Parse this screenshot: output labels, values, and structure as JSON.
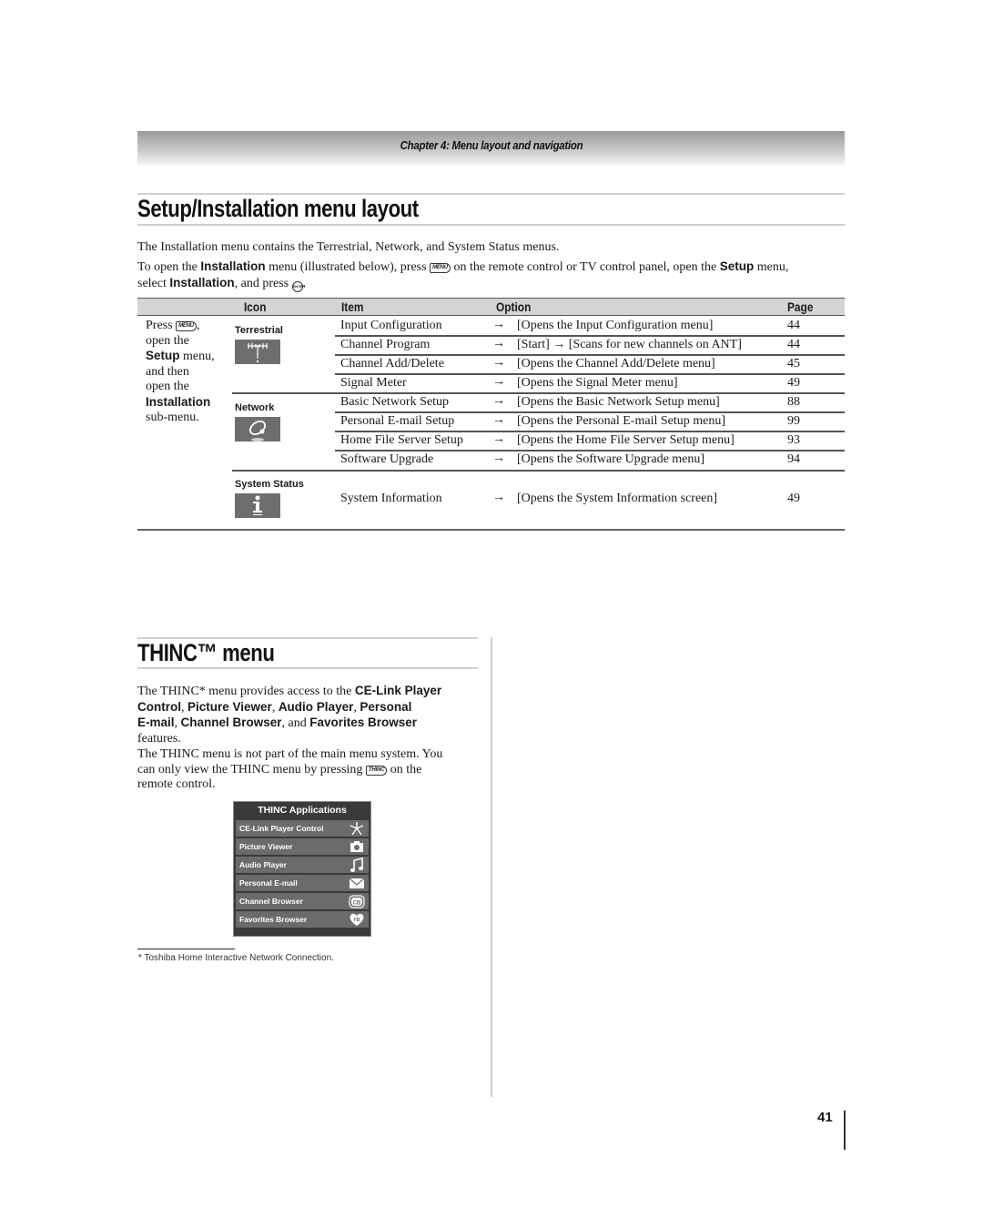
{
  "header": {
    "chapter": "Chapter 4: Menu layout and navigation"
  },
  "setup_section": {
    "title": "Setup/Installation menu layout",
    "intro": "The Installation menu contains the Terrestrial, Network, and System Status menus.",
    "instruction": {
      "p1": "To open the ",
      "b1": "Installation",
      "p2": " menu (illustrated below), press ",
      "key_menu": "MENU",
      "p3": " on the remote control or TV control panel, open the ",
      "b2": "Setup",
      "p4": " menu,",
      "p5": "select ",
      "b3": "Installation",
      "p6": ", and press ",
      "key_enter": "ENTER",
      "p7": "."
    }
  },
  "table": {
    "headers": {
      "icon": "Icon",
      "item": "Item",
      "option": "Option",
      "page": "Page"
    },
    "left_note": {
      "press": "Press ",
      "key": "MENU",
      "comma": ",",
      "l2": "open the",
      "setup": "Setup",
      "menu": " menu,",
      "l4": "and then",
      "l5": "open the",
      "installation": "Installation",
      "l7": "sub-menu."
    },
    "icon_groups": [
      {
        "label": "Terrestrial",
        "icon": "antenna-icon"
      },
      {
        "label": "Network",
        "icon": "network-icon"
      },
      {
        "label": "System Status",
        "icon": "info-icon"
      }
    ],
    "rows": [
      {
        "item": "Input Configuration",
        "option": "[Opens the Input Configuration menu]",
        "page": "44"
      },
      {
        "item": "Channel Program",
        "option": "[Start] → [Scans for new channels on ANT]",
        "page": "44"
      },
      {
        "item": "Channel Add/Delete",
        "option": "[Opens the Channel Add/Delete menu]",
        "page": "45"
      },
      {
        "item": "Signal Meter",
        "option": "[Opens the Signal Meter menu]",
        "page": "49"
      },
      {
        "item": "Basic Network Setup",
        "option": "[Opens the Basic Network Setup menu]",
        "page": "88"
      },
      {
        "item": "Personal E-mail Setup",
        "option": "[Opens the Personal E-mail Setup menu]",
        "page": "99"
      },
      {
        "item": "Home File Server Setup",
        "option": "[Opens the Home File Server Setup menu]",
        "page": "93"
      },
      {
        "item": "Software Upgrade",
        "option": "[Opens the Software Upgrade menu]",
        "page": "94"
      },
      {
        "item": "System Information",
        "option": "[Opens the System Information screen]",
        "page": "49"
      }
    ],
    "arrow": "→"
  },
  "thinc_section": {
    "title": "THINC™ menu",
    "para1": {
      "t1": "The THINC* menu provides access to the ",
      "b1": "CE-Link Player",
      "b2": "Control",
      "t2": ", ",
      "b3": "Picture Viewer",
      "t3": ", ",
      "b4": "Audio Player",
      "t4": ", ",
      "b5": "Personal",
      "b6": "E-mail",
      "t5": ", ",
      "b7": "Channel Browser",
      "t6": ", and ",
      "b8": "Favorites Browser",
      "t7": "features."
    },
    "para2": {
      "l1": "The THINC menu is not part of the main menu system. You",
      "l2a": "can only view the THINC menu by pressing ",
      "key": "THINC",
      "l2b": " on the",
      "l3": "remote control."
    },
    "apps_panel": {
      "title": "THINC Applications",
      "items": [
        {
          "label": "CE-Link Player Control",
          "icon": "asterisk-icon"
        },
        {
          "label": "Picture Viewer",
          "icon": "camera-icon"
        },
        {
          "label": "Audio Player",
          "icon": "music-note-icon"
        },
        {
          "label": "Personal E-mail",
          "icon": "envelope-icon"
        },
        {
          "label": "Channel Browser",
          "icon": "cb-icon",
          "badge": "CB"
        },
        {
          "label": "Favorites Browser",
          "icon": "heart-fb-icon",
          "badge": "FB"
        }
      ]
    },
    "footnote": "*  Toshiba Home Interactive Network Connection."
  },
  "page_number": "41"
}
